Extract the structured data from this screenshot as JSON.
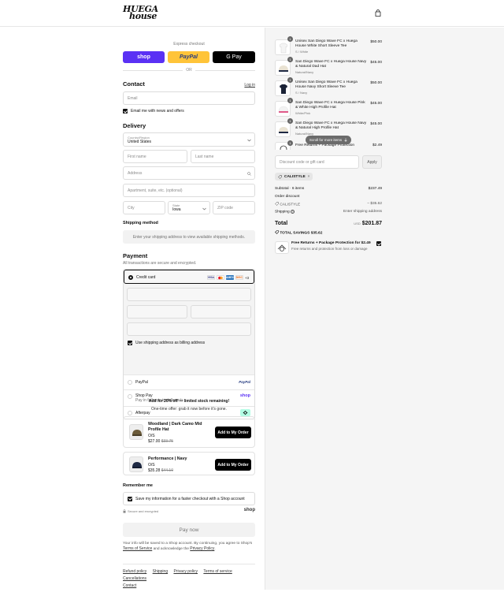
{
  "header": {
    "logo_line1": "HUEGA",
    "logo_line2": "house",
    "bag_icon": "shopping-bag-icon"
  },
  "express": {
    "label": "Express checkout",
    "shop": "shop",
    "paypal": "PayPal",
    "gpay": "G Pay",
    "or": "OR"
  },
  "contact": {
    "title": "Contact",
    "login": "Log in",
    "email_placeholder": "Email",
    "news_label": "Email me with news and offers"
  },
  "delivery": {
    "title": "Delivery",
    "country_label": "Country/Region",
    "country_value": "United States",
    "first_name": "First name",
    "last_name": "Last name",
    "address": "Address",
    "apartment": "Apartment, suite, etc. (optional)",
    "city": "City",
    "state_label": "State",
    "state_value": "Iowa",
    "zip": "ZIP code"
  },
  "shipping": {
    "title": "Shipping method",
    "note": "Enter your shipping address to view available shipping methods."
  },
  "payment": {
    "title": "Payment",
    "subtitle": "All transactions are secure and encrypted.",
    "credit_card": "Credit card",
    "card_icons": [
      "VISA",
      "MC",
      "AMEX",
      "DISC"
    ],
    "more_cards": "+3",
    "billing_label": "Use shipping address as billing address",
    "paypal": "PayPal",
    "paypal_logo": "PayPal",
    "shop_pay": "Shop Pay",
    "shop_pay_sub": "Pay in full or in installments",
    "shop_logo": "shop",
    "afterpay": "Afterpay"
  },
  "upsell": {
    "headline": "Add for 20% off — limited stock remaining!",
    "sub": "One-time offer: grab it now before it's gone.",
    "items": [
      {
        "name": "Woodland | Dark Camo Mid Profile Hat",
        "variant": "O/S",
        "price": "$27.00",
        "old_price": "$33.75",
        "button": "Add to My Order"
      },
      {
        "name": "Performance | Navy",
        "variant": "O/S",
        "price": "$35.28",
        "old_price": "$44.10",
        "button": "Add to My Order"
      }
    ]
  },
  "remember": {
    "title": "Remember me",
    "save_label": "Save my information for a faster checkout with a Shop account",
    "secure": "Secure and encrypted",
    "shop_logo": "shop"
  },
  "pay_now": "Pay now",
  "legal": {
    "text": "Your info will be saved to a Shop account. By continuing, you agree to Shop's",
    "terms": "Terms of Service",
    "and": "and acknowledge the",
    "privacy": "Privacy Policy",
    "end": "."
  },
  "footer_links": [
    "Refund policy",
    "Shipping",
    "Privacy policy",
    "Terms of service",
    "Cancellations",
    "Contact"
  ],
  "order": {
    "items": [
      {
        "qty": "1",
        "name": "Unisex San Diego Wave FC x Huega House White Short Sleeve Tee",
        "variant": "S / White",
        "price": "$50.00"
      },
      {
        "qty": "1",
        "name": "San Diego Wave FC x Huega House Navy & Natural Dad Hat",
        "variant": "Natural/Navy",
        "price": "$45.00"
      },
      {
        "qty": "1",
        "name": "Unisex San Diego Wave FC x Huega House Navy Short Sleeve Tee",
        "variant": "S / Navy",
        "price": "$50.00"
      },
      {
        "qty": "1",
        "name": "San Diego Wave FC x Huega House Pink & White High Profile Hat",
        "variant": "White/Pink",
        "price": "$45.00"
      },
      {
        "qty": "1",
        "name": "San Diego Wave FC x Huega House Navy & Natural High Profile Hat",
        "variant": "Natural/Navy",
        "price": "$45.00"
      },
      {
        "qty": "1",
        "name": "Free Returns + Package Protection",
        "variant": "",
        "price": "$2.49"
      }
    ],
    "scroll_hint": "Scroll for more items",
    "discount_placeholder": "Discount code or gift card",
    "apply": "Apply",
    "code_tag": "CALISTYLE",
    "subtotal_label": "Subtotal · 6 items",
    "subtotal": "$237.49",
    "discount_label": "Order discount",
    "discount_code": "CALISTYLE",
    "discount_value": "– $35.62",
    "shipping_label": "Shipping",
    "shipping_value": "Enter shipping address",
    "total_label": "Total",
    "currency": "USD",
    "total": "$201.87",
    "savings_label": "TOTAL SAVINGS",
    "savings": "$35.62",
    "protect_title": "Free Returns + Package Protection for $2.49",
    "protect_sub": "Free returns and protection from loss or damage"
  }
}
